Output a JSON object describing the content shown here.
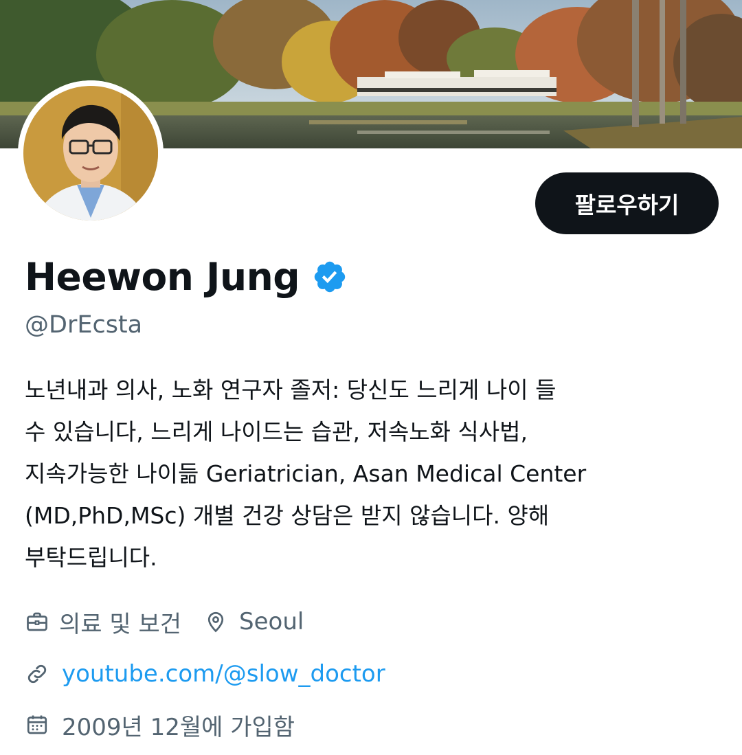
{
  "profile": {
    "name": "Heewon Jung",
    "handle": "@DrEcsta",
    "follow_label": "팔로우하기",
    "bio_lines": [
      "노년내과 의사, 노화 연구자 졸저: 당신도 느리게 나이 들",
      "수 있습니다, 느리게 나이드는 습관, 저속노화 식사법,",
      "지속가능한 나이듦 Geriatrician, Asan Medical Center",
      "(MD,PhD,MSc) 개별 건강 상담은 받지 않습니다. 양해",
      "부탁드립니다."
    ],
    "category": "의료 및 보건",
    "location": "Seoul",
    "link": "youtube.com/@slow_doctor",
    "joined": "2009년 12월에 가입함"
  },
  "icons": {
    "verified": "verified-badge-icon",
    "category": "briefcase-icon",
    "location": "location-pin-icon",
    "link": "link-icon",
    "joined": "calendar-icon"
  },
  "colors": {
    "text_primary": "#0f1419",
    "text_secondary": "#536471",
    "link": "#1d9bf0",
    "verified": "#1d9bf0",
    "follow_button_bg": "#0f1419",
    "follow_button_text": "#ffffff"
  }
}
